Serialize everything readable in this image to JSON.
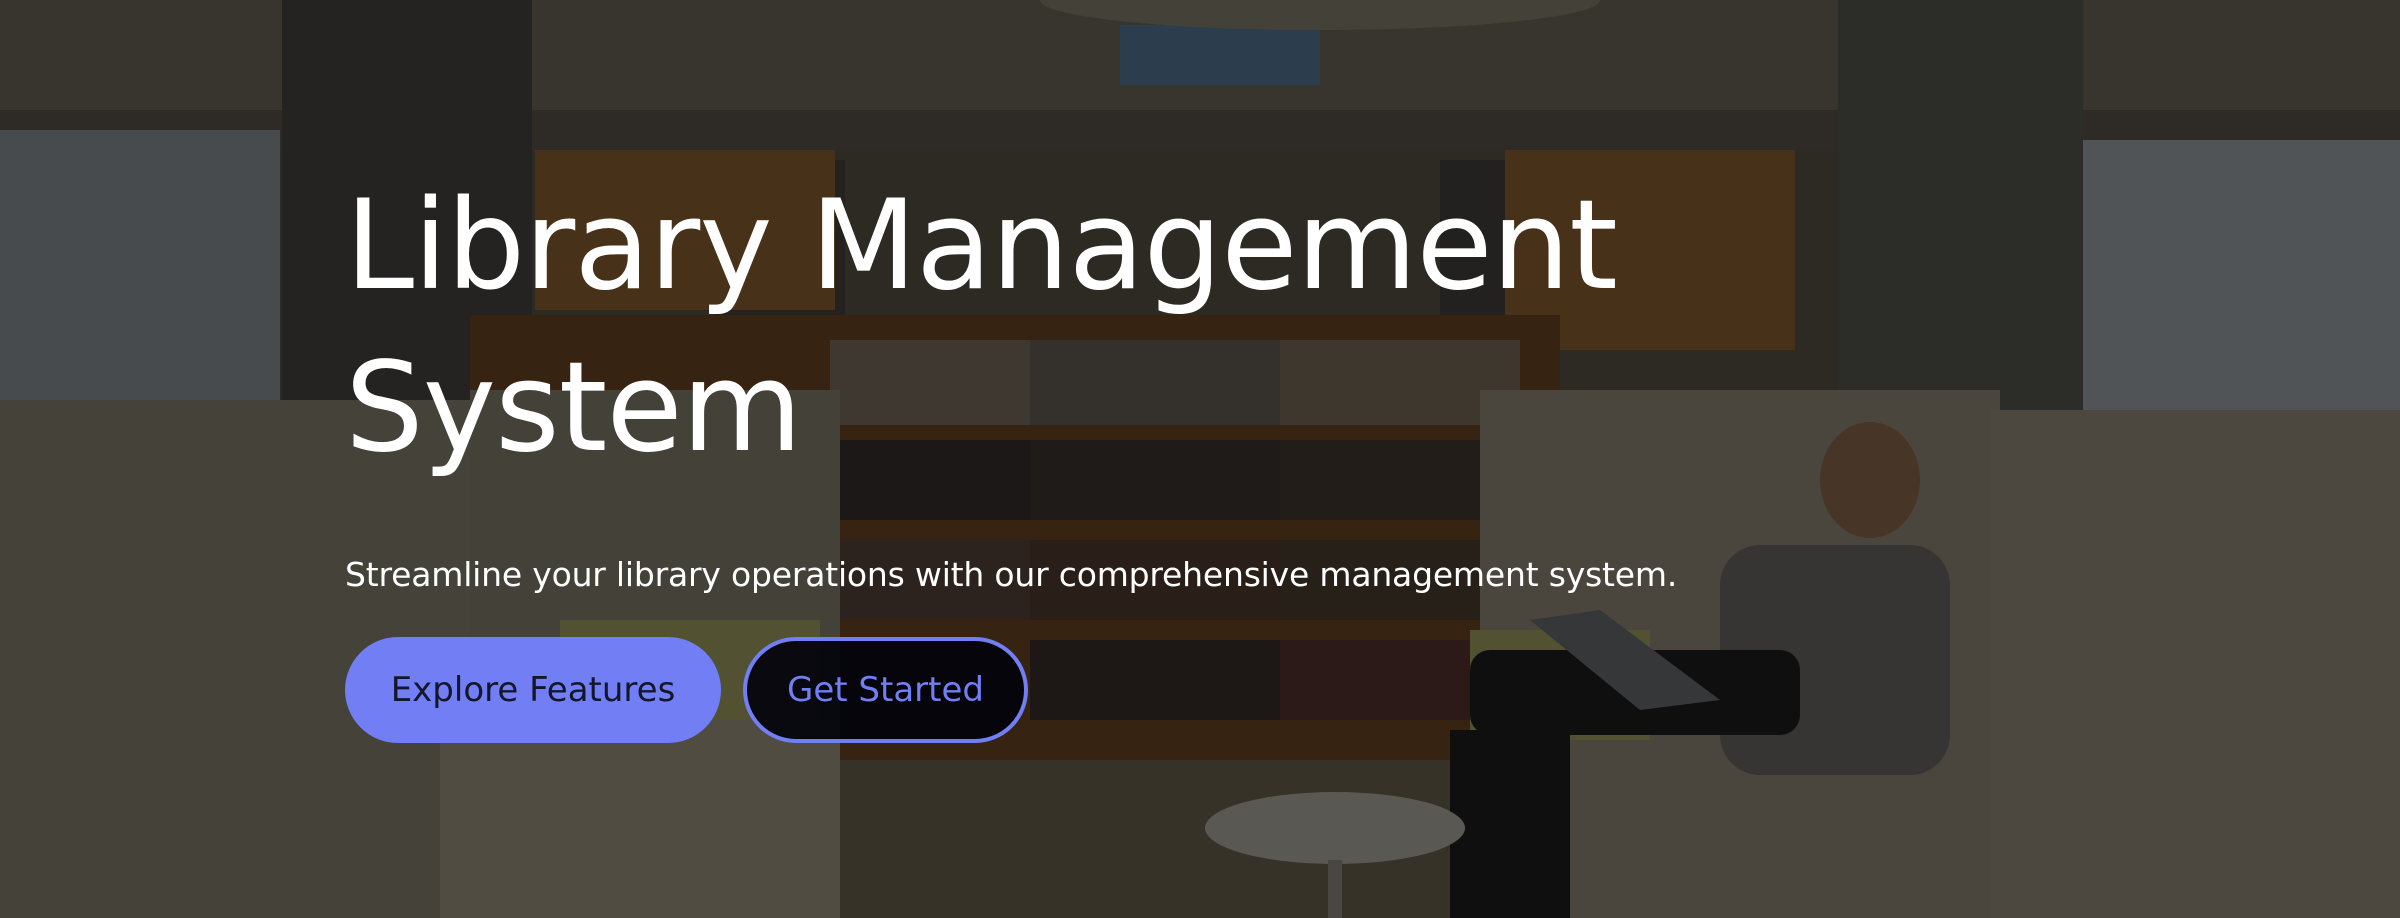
{
  "hero": {
    "title": "Library Management System",
    "subtitle": "Streamline your library operations with our comprehensive management system.",
    "background_image": "library-reading-room-photo"
  },
  "actions": {
    "primary_label": "Explore Features",
    "secondary_label": "Get Started"
  },
  "colors": {
    "accent": "#717ef4",
    "text": "#ffffff",
    "overlay": "rgba(8, 8, 10, 0.45)"
  }
}
